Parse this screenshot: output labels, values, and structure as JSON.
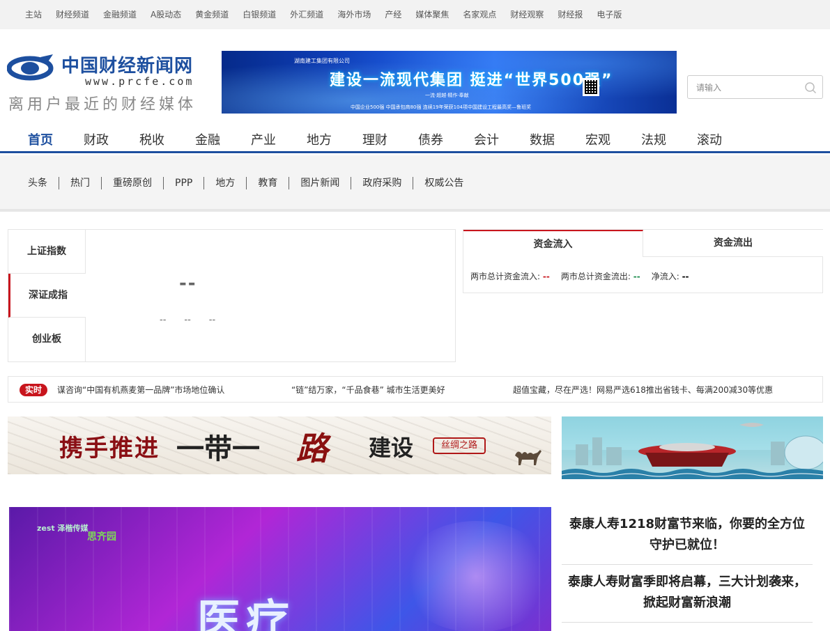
{
  "topbar": {
    "links": [
      "主站",
      "财经频道",
      "金融频道",
      "A股动态",
      "黄金频道",
      "白银频道",
      "外汇频道",
      "海外市场",
      "产经",
      "媒体聚焦",
      "名家观点",
      "财经观察",
      "财经报",
      "电子版"
    ]
  },
  "logo": {
    "name": "中国财经新闻网",
    "url": "www.prcfe.com",
    "slogan": "离用户最近的财经媒体"
  },
  "banner": {
    "corp": "湖南建工集团有限公司",
    "headline": "建设一流现代集团  挺进“世界500强”",
    "sub1": "一流·超越·精作·奉献",
    "sub2": "中国企业500强    中国承包商80强    连续19年荣获104项中国建设工程最高奖—鲁班奖"
  },
  "search": {
    "placeholder": "请输入",
    "icon": "search-icon"
  },
  "mainnav": {
    "items": [
      "首页",
      "财政",
      "税收",
      "金融",
      "产业",
      "地方",
      "理财",
      "债券",
      "会计",
      "数据",
      "宏观",
      "法规",
      "滚动"
    ],
    "active_index": 0
  },
  "subnav": {
    "items": [
      "头条",
      "热门",
      "重磅原创",
      "PPP",
      "地方",
      "教育",
      "图片新闻",
      "政府采购",
      "权威公告"
    ]
  },
  "index_panel": {
    "tabs": [
      "上证指数",
      "深证成指",
      "创业板"
    ],
    "active_index": 1,
    "value": "--",
    "stats": [
      "--",
      "--",
      "--"
    ]
  },
  "fund_panel": {
    "tabs": [
      "资金流入",
      "资金流出"
    ],
    "active_index": 0,
    "row": {
      "inflow_label": "两市总计资金流入:",
      "inflow_value": "--",
      "outflow_label": "两市总计资金流出:",
      "outflow_value": "--",
      "net_label": "净流入:",
      "net_value": "--"
    }
  },
  "ticker": {
    "badge": "实时",
    "news": [
      "谋咨询“中国有机燕麦第一品牌”市场地位确认",
      "“链”结万家，“千品食巷” 城市生活更美好",
      "超值宝藏，尽在严选！网易严选618推出省钱卡、每满200减30等优惠"
    ]
  },
  "ad_silk": {
    "text1": "携手推进",
    "text2": "一带一",
    "text3": "路",
    "text4": "建设",
    "seal": "丝绸之路"
  },
  "big_image": {
    "brand1": "zest 泽楷传媒",
    "brand2": "思齐园",
    "big_text": "医疗"
  },
  "headlines": [
    "泰康人寿1218财富节来临，你要的全方位守护已就位！",
    "泰康人寿财富季即将启幕，三大计划袭来，掀起财富新浪潮"
  ],
  "colors": {
    "brand_blue": "#1d4f9f",
    "accent_red": "#c8151d",
    "flow_green": "#1a8a4a"
  }
}
